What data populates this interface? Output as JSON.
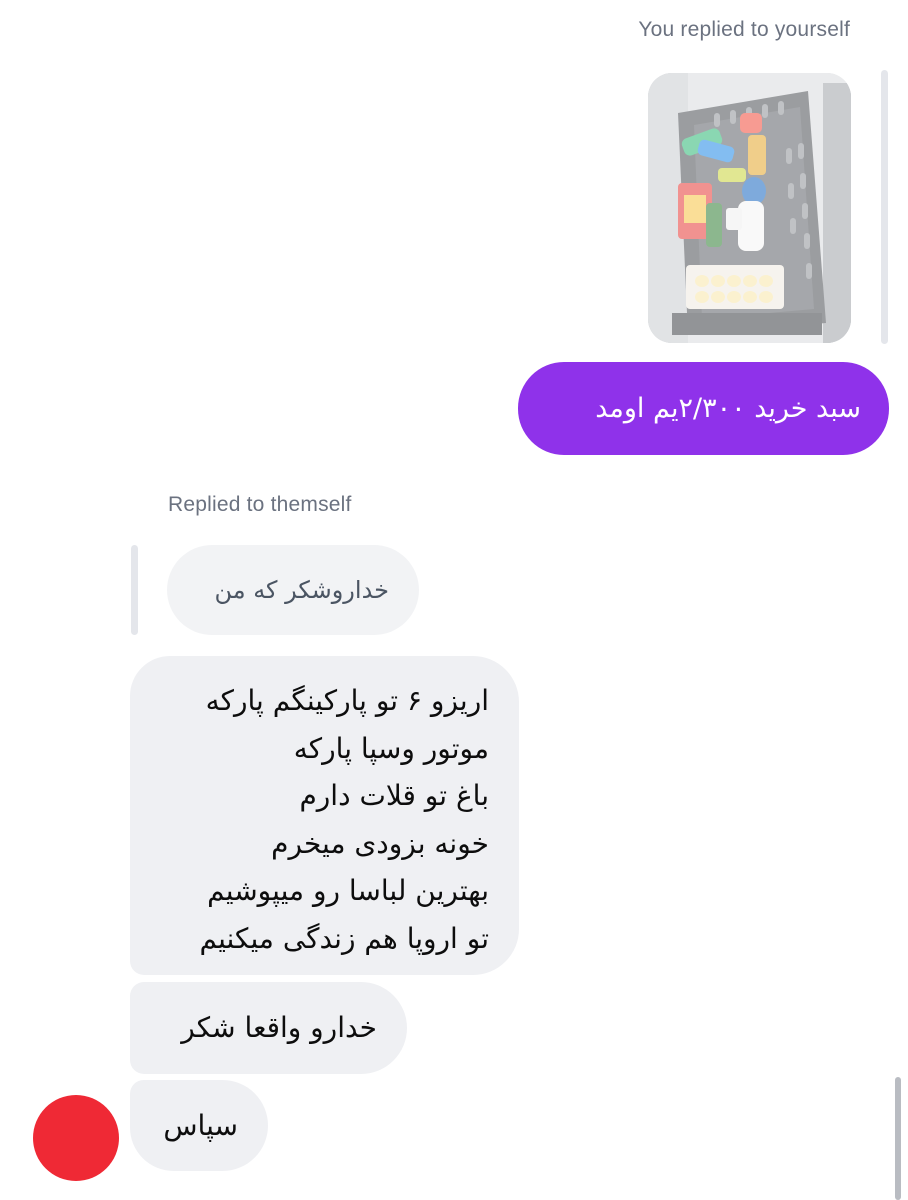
{
  "conversation": {
    "outgoing_reply_label": "You replied to yourself",
    "incoming_reply_label": "Replied to themself",
    "sent_message": "سبد خرید ۲/۳۰۰یم اومد",
    "quoted_message": "خداروشکر که من",
    "received_messages": {
      "poem_lines": [
        "اریزو ۶ تو پارکینگم پارکه",
        "موتور وسپا پارکه",
        "باغ تو قلات دارم",
        "خونه بزودی میخرم",
        "بهترین لباسا رو میپوشیم",
        "تو اروپا هم زندگی میکنیم"
      ],
      "thanks_god": "خدارو واقعا شکر",
      "thanks": "سپاس"
    }
  },
  "icons": {
    "avatar": "avatar-circle",
    "photo": "shopping-basket-photo"
  },
  "colors": {
    "sent_bubble": "#8f32ea",
    "received_bubble": "#eff0f3",
    "quoted_bubble": "#f2f3f5",
    "avatar": "#ef2935",
    "label_text": "#6b7280"
  }
}
